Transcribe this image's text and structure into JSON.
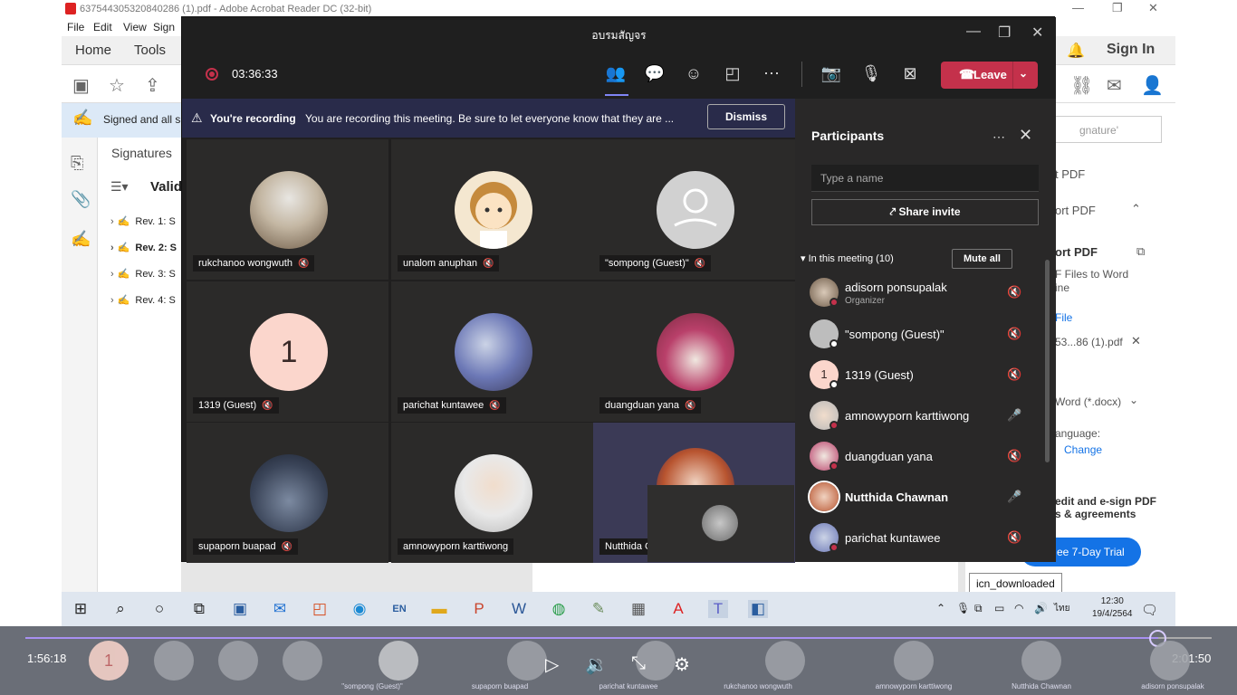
{
  "acrobat": {
    "title": "637544305320840286 (1).pdf - Adobe Acrobat Reader DC (32-bit)",
    "menu": [
      "File",
      "Edit",
      "View",
      "Sign"
    ],
    "nav": {
      "home": "Home",
      "tools": "Tools",
      "sign_in": "Sign In"
    },
    "banner_text": "Signed and all s",
    "signatures_header": "Signatures",
    "validate_label": "Valid",
    "revisions": [
      "Rev. 1: S",
      "Rev. 2: S",
      "Rev. 3: S",
      "Rev. 4: S"
    ],
    "right_panel": {
      "search_placeholder": "gnature'",
      "export1": "t PDF",
      "export2": "ort PDF",
      "export3": "ort PDF",
      "convert_desc1": "F Files to Word",
      "convert_desc2": "ine",
      "file_label": "File",
      "file_name": "53...86 (1).pdf",
      "format": "Word (*.docx)",
      "language_label": "anguage:",
      "change_link": "Change",
      "promo1": "edit and e-sign PDF",
      "promo2": "s & agreements",
      "trial_button": "ee 7-Day Trial"
    },
    "tooltip": "icn_downloaded"
  },
  "taskbar": {
    "time": "12:30",
    "date": "19/4/2564",
    "lang_tray": "ไทย",
    "en_label": "EN"
  },
  "player": {
    "elapsed": "1:56:18",
    "total": "2:01:50",
    "progress": 0.955,
    "thumb_labels": [
      "\"sompong (Guest)\"",
      "supaporn buapad",
      "parichat kuntawee",
      "rukchanoo wongwuth",
      "amnowyporn karttiwong",
      "Nutthida Chawnan",
      "adisorn ponsupalak"
    ],
    "first_thumb_number": "1"
  },
  "teams": {
    "window_title": "อบรมสัญจร",
    "rec_time": "03:36:33",
    "leave_label": "Leave",
    "rec_banner": {
      "bold": "You're recording",
      "message": "You are recording this meeting. Be sure to let everyone know that they are ...",
      "dismiss": "Dismiss"
    },
    "tiles": [
      {
        "name": "rukchanoo wongwuth"
      },
      {
        "name": "unalom anuphan"
      },
      {
        "name": "\"sompong (Guest)\""
      },
      {
        "name": "1319 (Guest)",
        "initial": "1"
      },
      {
        "name": "parichat kuntawee"
      },
      {
        "name": "duangduan yana"
      },
      {
        "name": "supaporn buapad"
      },
      {
        "name": "amnowyporn karttiwong"
      },
      {
        "name": "Nutthida C"
      }
    ],
    "participants": {
      "title": "Participants",
      "search_placeholder": "Type a name",
      "share_invite": "Share invite",
      "in_meeting": "In this meeting (10)",
      "mute_all": "Mute all",
      "list": [
        {
          "name": "adisorn ponsupalak",
          "role": "Organizer"
        },
        {
          "name": "\"sompong (Guest)\""
        },
        {
          "name": "1319 (Guest)",
          "initial": "1"
        },
        {
          "name": "amnowyporn karttiwong"
        },
        {
          "name": "duangduan yana"
        },
        {
          "name": "Nutthida Chawnan"
        },
        {
          "name": "parichat kuntawee"
        }
      ]
    },
    "colors": {
      "leave": "#c4314b",
      "accent": "#7f85f5",
      "banner": "#292b4a"
    }
  }
}
